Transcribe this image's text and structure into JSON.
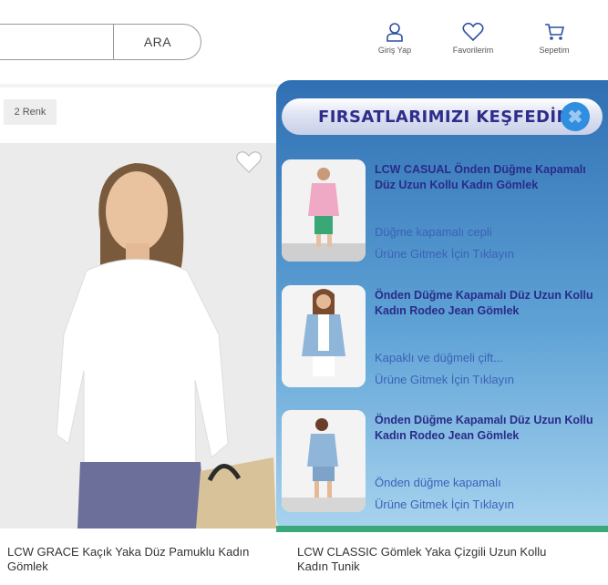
{
  "header": {
    "search_button": "ARA",
    "login_label": "Giriş Yap",
    "favorites_label": "Favorilerim",
    "cart_label": "Sepetim"
  },
  "listing": {
    "color_badge": "2 Renk",
    "products": [
      {
        "name": "LCW GRACE Kaçık Yaka Düz Pamuklu Kadın Gömlek"
      },
      {
        "name": "LCW CLASSIC Gömlek Yaka Çizgili Uzun Kollu Kadın Tunik"
      }
    ]
  },
  "popup": {
    "title": "FIRSATLARIMIZI KEŞFEDİN",
    "colors": {
      "title": "#2e2d8c",
      "link": "#3b62b8",
      "accent": "#2f8ee0"
    },
    "offers": [
      {
        "title": "LCW CASUAL Önden Düğme Kapamalı Düz Uzun Kollu Kadın Gömlek",
        "description": "Düğme kapamalı cepli",
        "cta": "Ürüne Gitmek İçin Tıklayın"
      },
      {
        "title": "Önden Düğme Kapamalı Düz Uzun Kollu Kadın Rodeo Jean Gömlek",
        "description": "Kapaklı ve düğmeli çift...",
        "cta": "Ürüne Gitmek İçin Tıklayın"
      },
      {
        "title": "Önden Düğme Kapamalı Düz Uzun Kollu Kadın Rodeo Jean Gömlek",
        "description": "Önden düğme kapamalı",
        "cta": "Ürüne Gitmek İçin Tıklayın"
      }
    ]
  }
}
